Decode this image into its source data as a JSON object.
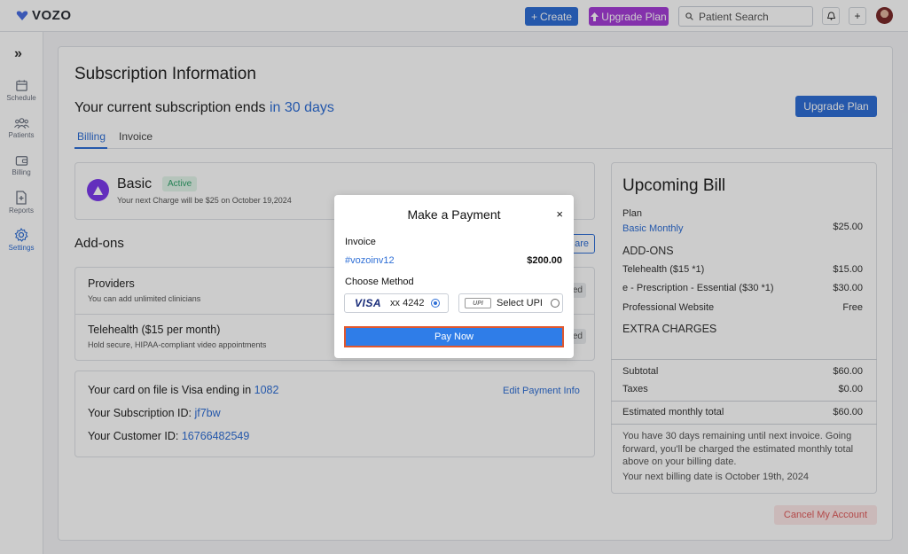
{
  "app": {
    "logo_text": "VOZO",
    "brand_color": "#2f6fd6"
  },
  "topbar": {
    "create_label": "Create",
    "upgrade_label": "Upgrade Plan",
    "search_placeholder": "Patient Search"
  },
  "sidebar": {
    "items": [
      {
        "label": "Schedule",
        "icon": "calendar-icon",
        "active": false
      },
      {
        "label": "Patients",
        "icon": "patients-icon",
        "active": false
      },
      {
        "label": "Billing",
        "icon": "wallet-icon",
        "active": false
      },
      {
        "label": "Reports",
        "icon": "report-icon",
        "active": false
      },
      {
        "label": "Settings",
        "icon": "gear-icon",
        "active": true
      }
    ]
  },
  "main": {
    "title": "Subscription Information",
    "sub_ends_prefix": "Your current subscription ends ",
    "sub_ends_days": "in 30 days",
    "upgrade_label": "Upgrade Plan",
    "tabs": [
      {
        "label": "Billing",
        "active": true
      },
      {
        "label": "Invoice",
        "active": false
      }
    ],
    "plan": {
      "name": "Basic",
      "status": "Active",
      "next_charge": "Your next Charge will be $25 on October 19,2024"
    },
    "addons_title": "Add-ons",
    "compare_label": "are",
    "addons": [
      {
        "name": "Providers",
        "desc": "You can add unlimited clinicians",
        "badge": "ed"
      },
      {
        "name": "Telehealth ($15 per month)",
        "desc": "Hold secure, HIPAA-compliant video appointments",
        "badge": "ed"
      }
    ],
    "card": {
      "card_prefix": "Your card on file is Visa ending in ",
      "card_last4": "1082",
      "edit_label": "Edit Payment Info",
      "sub_id_prefix": "Your Subscription ID: ",
      "sub_id": "jf7bw",
      "cust_id_prefix": "Your Customer ID: ",
      "cust_id": "16766482549"
    }
  },
  "bill": {
    "title": "Upcoming Bill",
    "plan_label": "Plan",
    "plan_name": "Basic Monthly",
    "plan_price": "$25.00",
    "addons_head": "ADD-ONS",
    "addons": [
      {
        "label": "Telehealth  ($15 *1)",
        "value": "$15.00"
      },
      {
        "label": "e - Prescription - Essential ($30 *1)",
        "value": "$30.00"
      },
      {
        "label": "Professional Website",
        "value": "Free"
      }
    ],
    "extra_head": "EXTRA CHARGES",
    "subtotal_label": "Subtotal",
    "subtotal": "$60.00",
    "taxes_label": "Taxes",
    "taxes": "$0.00",
    "est_label": "Estimated monthly total",
    "est": "$60.00",
    "note1": "You have 30 days remaining until next invoice. Going forward, you'll be charged the estimated monthly total above on your billing date.",
    "note2": "Your next billing date is October 19th, 2024"
  },
  "cancel_label": "Cancel My Account",
  "modal": {
    "title": "Make a Payment",
    "close": "×",
    "invoice_label": "Invoice",
    "invoice_id": "#vozoinv12",
    "amount": "$200.00",
    "method_label": "Choose Method",
    "visa_brand": "VISA",
    "visa_text": "xx 4242",
    "upi_brand": "UPI",
    "upi_text": "Select UPI",
    "pay_label": "Pay Now"
  }
}
